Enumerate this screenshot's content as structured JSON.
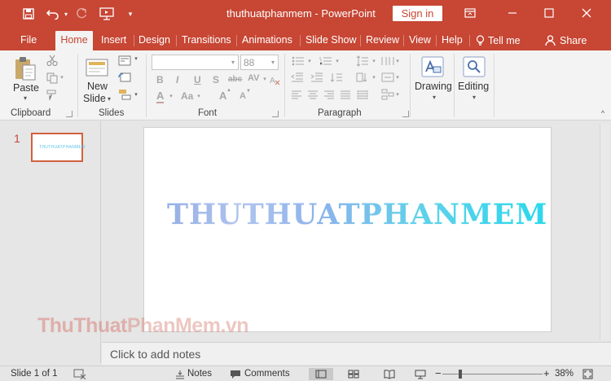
{
  "window": {
    "title": "thuthuatphanmem  -  PowerPoint",
    "sign_in": "Sign in"
  },
  "tabs": [
    {
      "label": "File"
    },
    {
      "label": "Home"
    },
    {
      "label": "Insert"
    },
    {
      "label": "Design"
    },
    {
      "label": "Transitions"
    },
    {
      "label": "Animations"
    },
    {
      "label": "Slide Show"
    },
    {
      "label": "Review"
    },
    {
      "label": "View"
    },
    {
      "label": "Help"
    },
    {
      "label": "Tell me"
    },
    {
      "label": "Share"
    }
  ],
  "ribbon": {
    "clipboard": {
      "paste": "Paste",
      "group": "Clipboard"
    },
    "slides": {
      "new_slide_line1": "New",
      "new_slide_line2": "Slide",
      "group": "Slides"
    },
    "font": {
      "font_name": "",
      "font_size": "88",
      "group": "Font",
      "bold": "B",
      "italic": "I",
      "underline": "U",
      "shadow": "S",
      "strike": "abc",
      "spacing": "AV",
      "font_color": "A",
      "case": "Aa",
      "grow": "A",
      "shrink": "A"
    },
    "paragraph": {
      "group": "Paragraph"
    },
    "drawing": {
      "label": "Drawing"
    },
    "editing": {
      "label": "Editing"
    }
  },
  "slide_panel": {
    "number": "1",
    "thumb_text": "THUTHUATPHANMEM"
  },
  "slide": {
    "title_text": "THUTHUATPHANMEM"
  },
  "notes": {
    "placeholder": "Click to add notes"
  },
  "watermark": {
    "part1": "ThuThuat",
    "part2": "PhanMem.vn"
  },
  "status": {
    "slide_info": "Slide 1 of 1",
    "notes": "Notes",
    "comments": "Comments",
    "zoom": "38%",
    "zoom_minus": "−",
    "zoom_plus": "+"
  },
  "colors": {
    "accent": "#c74634",
    "ribbon_bg": "#f3f3f3"
  }
}
